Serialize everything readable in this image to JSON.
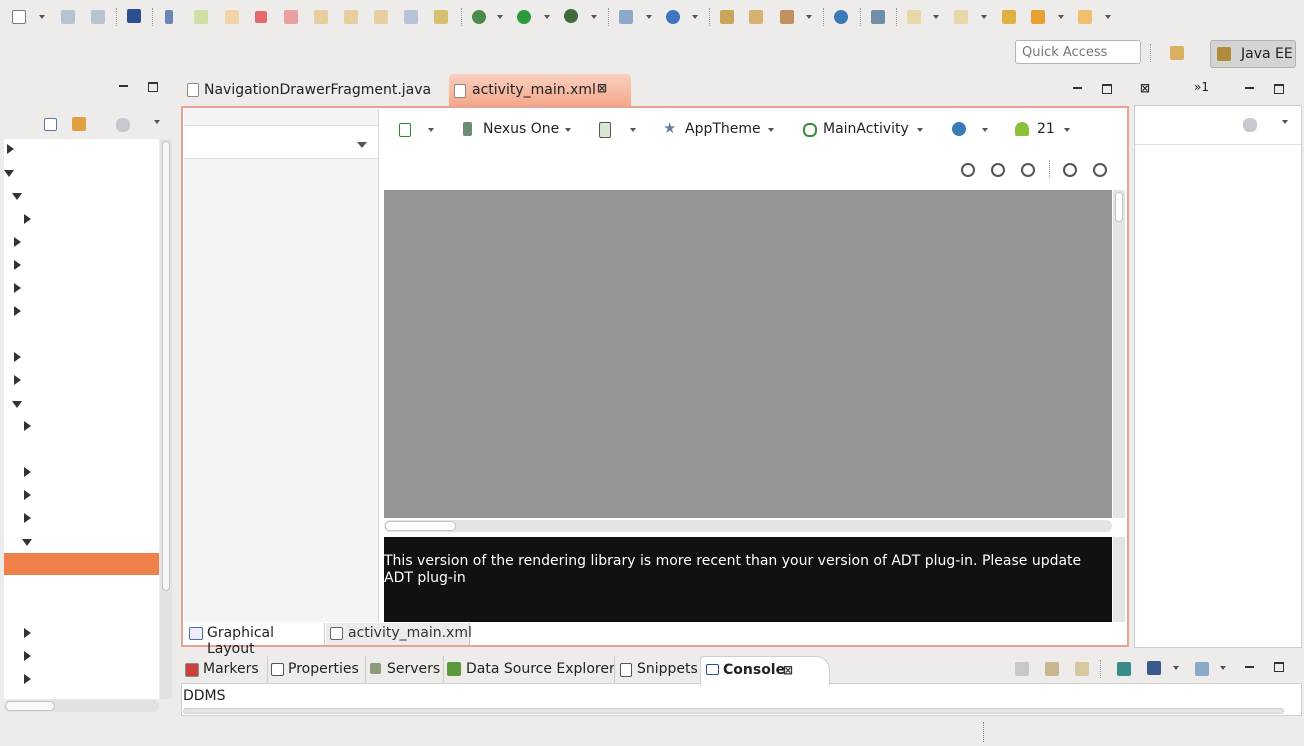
{
  "toolbar": {
    "icons": [
      "new-icon",
      "save-icon",
      "save-all-icon",
      "terminal-icon",
      "step-icon",
      "resume-icon",
      "suspend-icon",
      "stop-icon",
      "disconnect-icon",
      "step-into-icon",
      "step-over-icon",
      "step-return-icon",
      "drop-frame-icon",
      "use-step-filters-icon",
      "debug-icon",
      "run-icon",
      "external-tools-icon",
      "new-android-icon",
      "new-class-icon",
      "open-type-icon",
      "open-task-icon",
      "search-icon",
      "globe-icon",
      "run-last-icon",
      "next-annotation-icon",
      "prev-annotation-icon",
      "last-edit-icon",
      "back-icon",
      "forward-icon"
    ]
  },
  "quick_access": {
    "placeholder": "Quick Access"
  },
  "perspective": {
    "label": "Java EE"
  },
  "editor": {
    "tabs": [
      {
        "label": "NavigationDrawerFragment.java",
        "active": false
      },
      {
        "label": "activity_main.xml",
        "active": true
      }
    ]
  },
  "layout_toolbar": {
    "device": "Nexus One",
    "theme": "AppTheme",
    "activity": "MainActivity",
    "api": "21"
  },
  "render_message": "This version of the rendering library is more recent than your version of ADT plug-in. Please update ADT plug-in",
  "editor_bottom_tabs": [
    {
      "label": "Graphical Layout",
      "active": true
    },
    {
      "label": "activity_main.xml",
      "active": false
    }
  ],
  "bottom_panel": {
    "tabs": [
      "Markers",
      "Properties",
      "Servers",
      "Data Source Explorer",
      "Snippets",
      "Console"
    ],
    "active_tab": "Console",
    "console_name": "DDMS"
  },
  "right_panel": {
    "tab_label": "»1"
  },
  "colors": {
    "accent": "#f0814a",
    "active_border": "#e8a294",
    "canvas": "#959595",
    "message_bg": "#111111"
  }
}
